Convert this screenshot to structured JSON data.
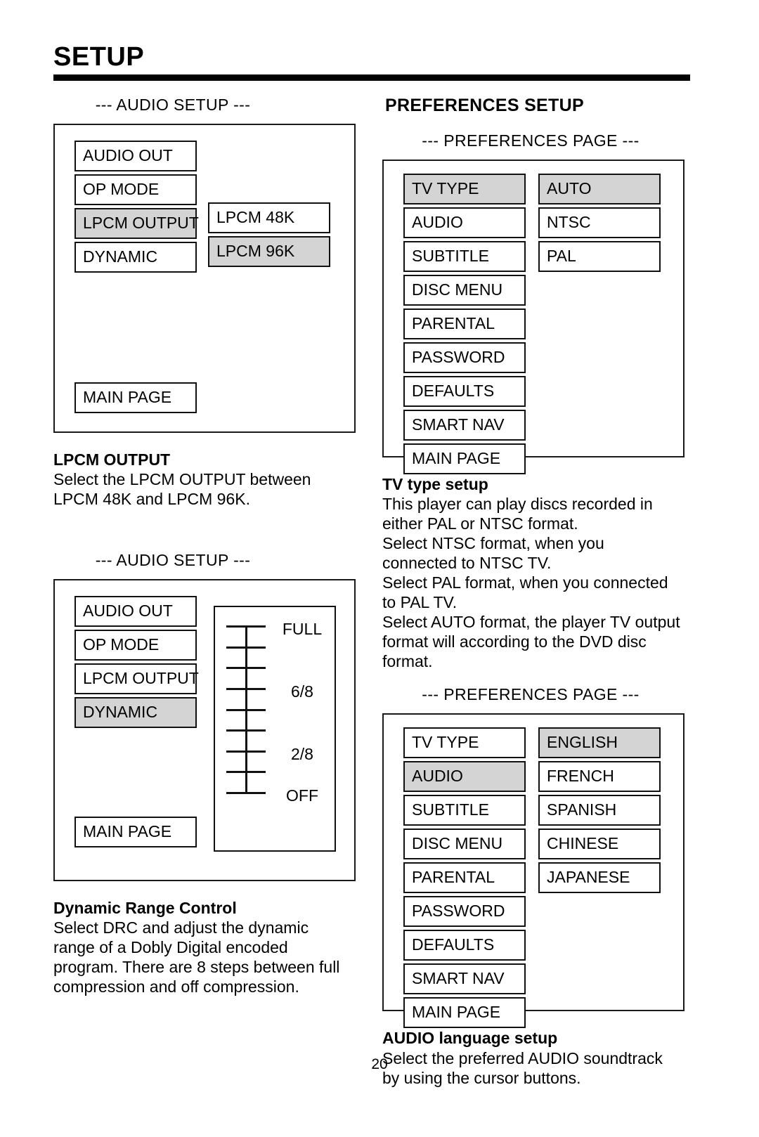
{
  "document": {
    "title": "SETUP",
    "page_number": "20"
  },
  "left_column": {
    "audio_setup_caption_1": "--- AUDIO SETUP ---",
    "audio_screen_1": {
      "menu_items": [
        {
          "label": "AUDIO OUT",
          "highlighted": false
        },
        {
          "label": "OP MODE",
          "highlighted": false
        },
        {
          "label": "LPCM OUTPUT",
          "highlighted": true
        },
        {
          "label": "DYNAMIC",
          "highlighted": false
        }
      ],
      "options": [
        {
          "label": "LPCM 48K",
          "highlighted": false
        },
        {
          "label": "LPCM 96K",
          "highlighted": true
        }
      ],
      "main_page_label": "MAIN PAGE"
    },
    "lpcm_text": {
      "heading": "LPCM OUTPUT",
      "line1": "Select the LPCM OUTPUT between",
      "line2": "LPCM 48K and LPCM 96K."
    },
    "audio_setup_caption_2": "--- AUDIO SETUP ---",
    "audio_screen_2": {
      "menu_items": [
        {
          "label": "AUDIO OUT",
          "highlighted": false
        },
        {
          "label": "OP MODE",
          "highlighted": false
        },
        {
          "label": "LPCM OUTPUT",
          "highlighted": false
        },
        {
          "label": "DYNAMIC",
          "highlighted": true
        }
      ],
      "drc_scale": {
        "tick_count": 9,
        "labels": [
          {
            "text": "FULL",
            "position_index": 0
          },
          {
            "text": "6/8",
            "position_index": 3
          },
          {
            "text": "2/8",
            "position_index": 6
          },
          {
            "text": "OFF",
            "position_index": 8
          }
        ]
      },
      "main_page_label": "MAIN PAGE"
    },
    "drc_text": {
      "heading": "Dynamic Range Control",
      "line1": "Select DRC and adjust the dynamic",
      "line2": "range of a Dobly Digital encoded",
      "line3": "program.  There are 8 steps between full",
      "line4": "compression and off compression."
    }
  },
  "right_column": {
    "section_heading": "PREFERENCES SETUP",
    "prefs_caption_1": "--- PREFERENCES PAGE ---",
    "prefs_screen_1": {
      "menu_items": [
        {
          "label": "TV TYPE",
          "highlighted": true
        },
        {
          "label": "AUDIO",
          "highlighted": false
        },
        {
          "label": "SUBTITLE",
          "highlighted": false
        },
        {
          "label": "DISC MENU",
          "highlighted": false
        },
        {
          "label": "PARENTAL",
          "highlighted": false
        },
        {
          "label": "PASSWORD",
          "highlighted": false
        },
        {
          "label": "DEFAULTS",
          "highlighted": false
        },
        {
          "label": "SMART NAV",
          "highlighted": false
        },
        {
          "label": "MAIN PAGE",
          "highlighted": false
        }
      ],
      "options": [
        {
          "label": "AUTO",
          "highlighted": true
        },
        {
          "label": "NTSC",
          "highlighted": false
        },
        {
          "label": "PAL",
          "highlighted": false
        }
      ]
    },
    "tv_type_text": {
      "heading": "TV type setup",
      "line1": "This player can play discs recorded in",
      "line2": "either PAL or NTSC format.",
      "line3": "Select NTSC format, when you",
      "line4": "connected to NTSC TV.",
      "line5": "Select PAL format, when you connected",
      "line6": "to PAL TV.",
      "line7": "Select AUTO format, the player TV output",
      "line8": "format will according to the DVD disc",
      "line9": "format."
    },
    "prefs_caption_2": "--- PREFERENCES PAGE ---",
    "prefs_screen_2": {
      "menu_items": [
        {
          "label": "TV TYPE",
          "highlighted": false
        },
        {
          "label": "AUDIO",
          "highlighted": true
        },
        {
          "label": "SUBTITLE",
          "highlighted": false
        },
        {
          "label": "DISC MENU",
          "highlighted": false
        },
        {
          "label": "PARENTAL",
          "highlighted": false
        },
        {
          "label": "PASSWORD",
          "highlighted": false
        },
        {
          "label": "DEFAULTS",
          "highlighted": false
        },
        {
          "label": "SMART NAV",
          "highlighted": false
        },
        {
          "label": "MAIN PAGE",
          "highlighted": false
        }
      ],
      "options": [
        {
          "label": "ENGLISH",
          "highlighted": true
        },
        {
          "label": "FRENCH",
          "highlighted": false
        },
        {
          "label": "SPANISH",
          "highlighted": false
        },
        {
          "label": "CHINESE",
          "highlighted": false
        },
        {
          "label": "JAPANESE",
          "highlighted": false
        }
      ]
    },
    "audio_lang_text": {
      "heading": "AUDIO language setup",
      "line1": "Select the preferred AUDIO soundtrack",
      "line2": "by using the cursor buttons."
    }
  },
  "colors": {
    "highlight": "#d4d4d4",
    "border": "#111111",
    "rule": "#000000"
  }
}
